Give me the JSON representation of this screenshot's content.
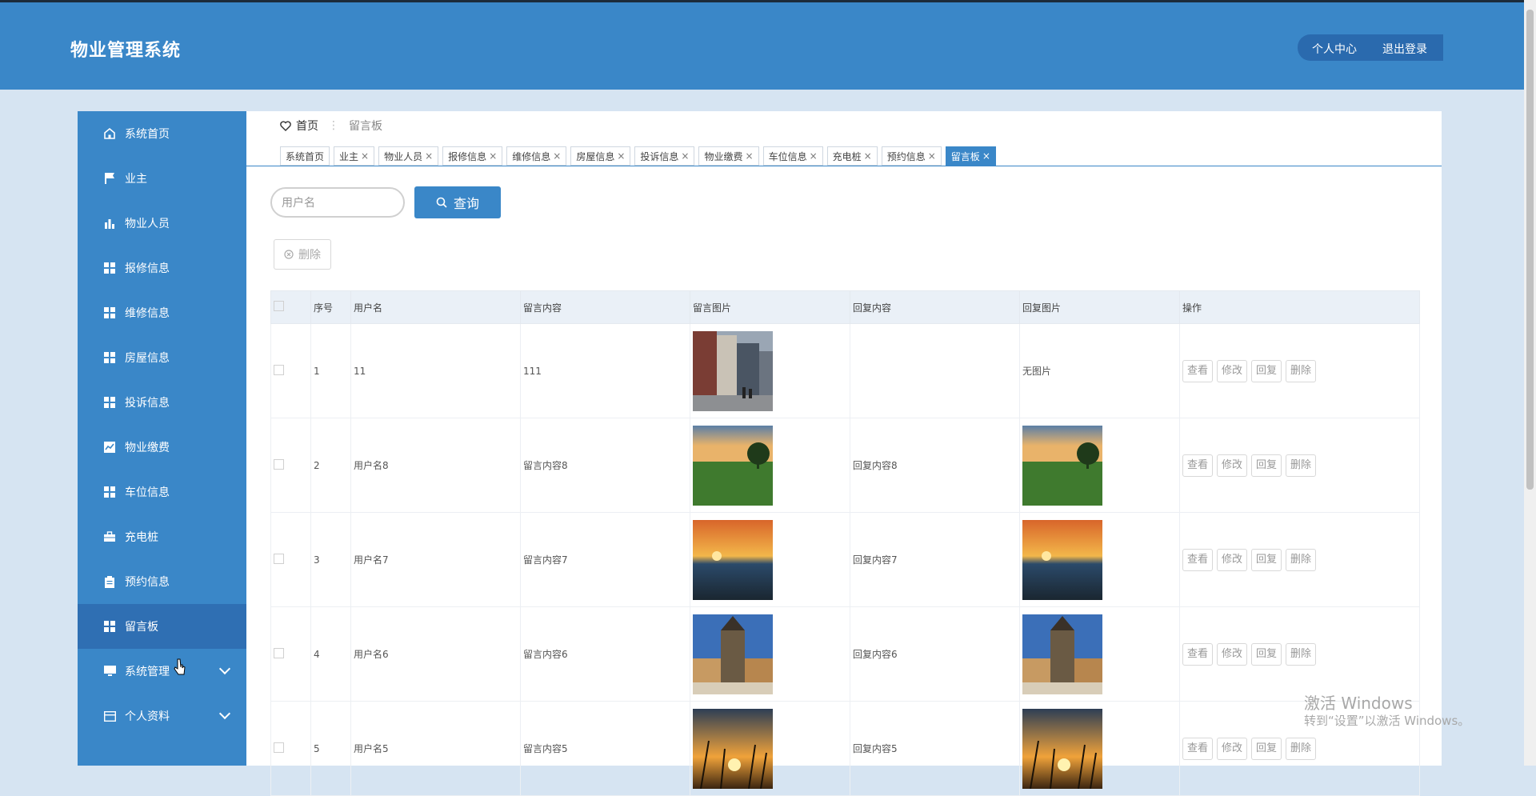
{
  "header": {
    "title": "物业管理系统",
    "user_center": "个人中心",
    "logout": "退出登录"
  },
  "sidebar": {
    "items": [
      {
        "label": "系统首页",
        "icon": "home-icon"
      },
      {
        "label": "业主",
        "icon": "flag-icon"
      },
      {
        "label": "物业人员",
        "icon": "bar-chart-icon"
      },
      {
        "label": "报修信息",
        "icon": "grid-icon"
      },
      {
        "label": "维修信息",
        "icon": "grid-icon"
      },
      {
        "label": "房屋信息",
        "icon": "grid-icon"
      },
      {
        "label": "投诉信息",
        "icon": "grid-icon"
      },
      {
        "label": "物业缴费",
        "icon": "chart-box-icon"
      },
      {
        "label": "车位信息",
        "icon": "grid-icon"
      },
      {
        "label": "充电桩",
        "icon": "briefcase-icon"
      },
      {
        "label": "预约信息",
        "icon": "clipboard-icon"
      },
      {
        "label": "留言板",
        "icon": "grid-icon",
        "active": true
      },
      {
        "label": "系统管理",
        "icon": "monitor-icon",
        "expandable": true
      },
      {
        "label": "个人资料",
        "icon": "card-icon",
        "expandable": true
      }
    ]
  },
  "breadcrumb": {
    "home": "首页",
    "current": "留言板"
  },
  "tabs": [
    "系统首页",
    "业主",
    "物业人员",
    "报修信息",
    "维修信息",
    "房屋信息",
    "投诉信息",
    "物业缴费",
    "车位信息",
    "充电桩",
    "预约信息",
    "留言板"
  ],
  "search": {
    "placeholder": "用户名",
    "button": "查询"
  },
  "toolbar": {
    "delete": "删除"
  },
  "table": {
    "headers": [
      "序号",
      "用户名",
      "留言内容",
      "留言图片",
      "回复内容",
      "回复图片",
      "操作"
    ],
    "actions": [
      "查看",
      "修改",
      "回复",
      "删除"
    ],
    "rows": [
      {
        "no": "1",
        "user": "11",
        "content": "111",
        "reply": "",
        "reply_img_text": "无图片",
        "img": "street"
      },
      {
        "no": "2",
        "user": "用户名8",
        "content": "留言内容8",
        "reply": "回复内容8",
        "img": "field"
      },
      {
        "no": "3",
        "user": "用户名7",
        "content": "留言内容7",
        "reply": "回复内容7",
        "img": "sunset-sea"
      },
      {
        "no": "4",
        "user": "用户名6",
        "content": "留言内容6",
        "reply": "回复内容6",
        "img": "castle"
      },
      {
        "no": "5",
        "user": "用户名5",
        "content": "留言内容5",
        "reply": "回复内容5",
        "img": "sunset-grass"
      }
    ]
  },
  "watermark": {
    "line1": "激活 Windows",
    "line2": "转到“设置”以激活 Windows。"
  }
}
